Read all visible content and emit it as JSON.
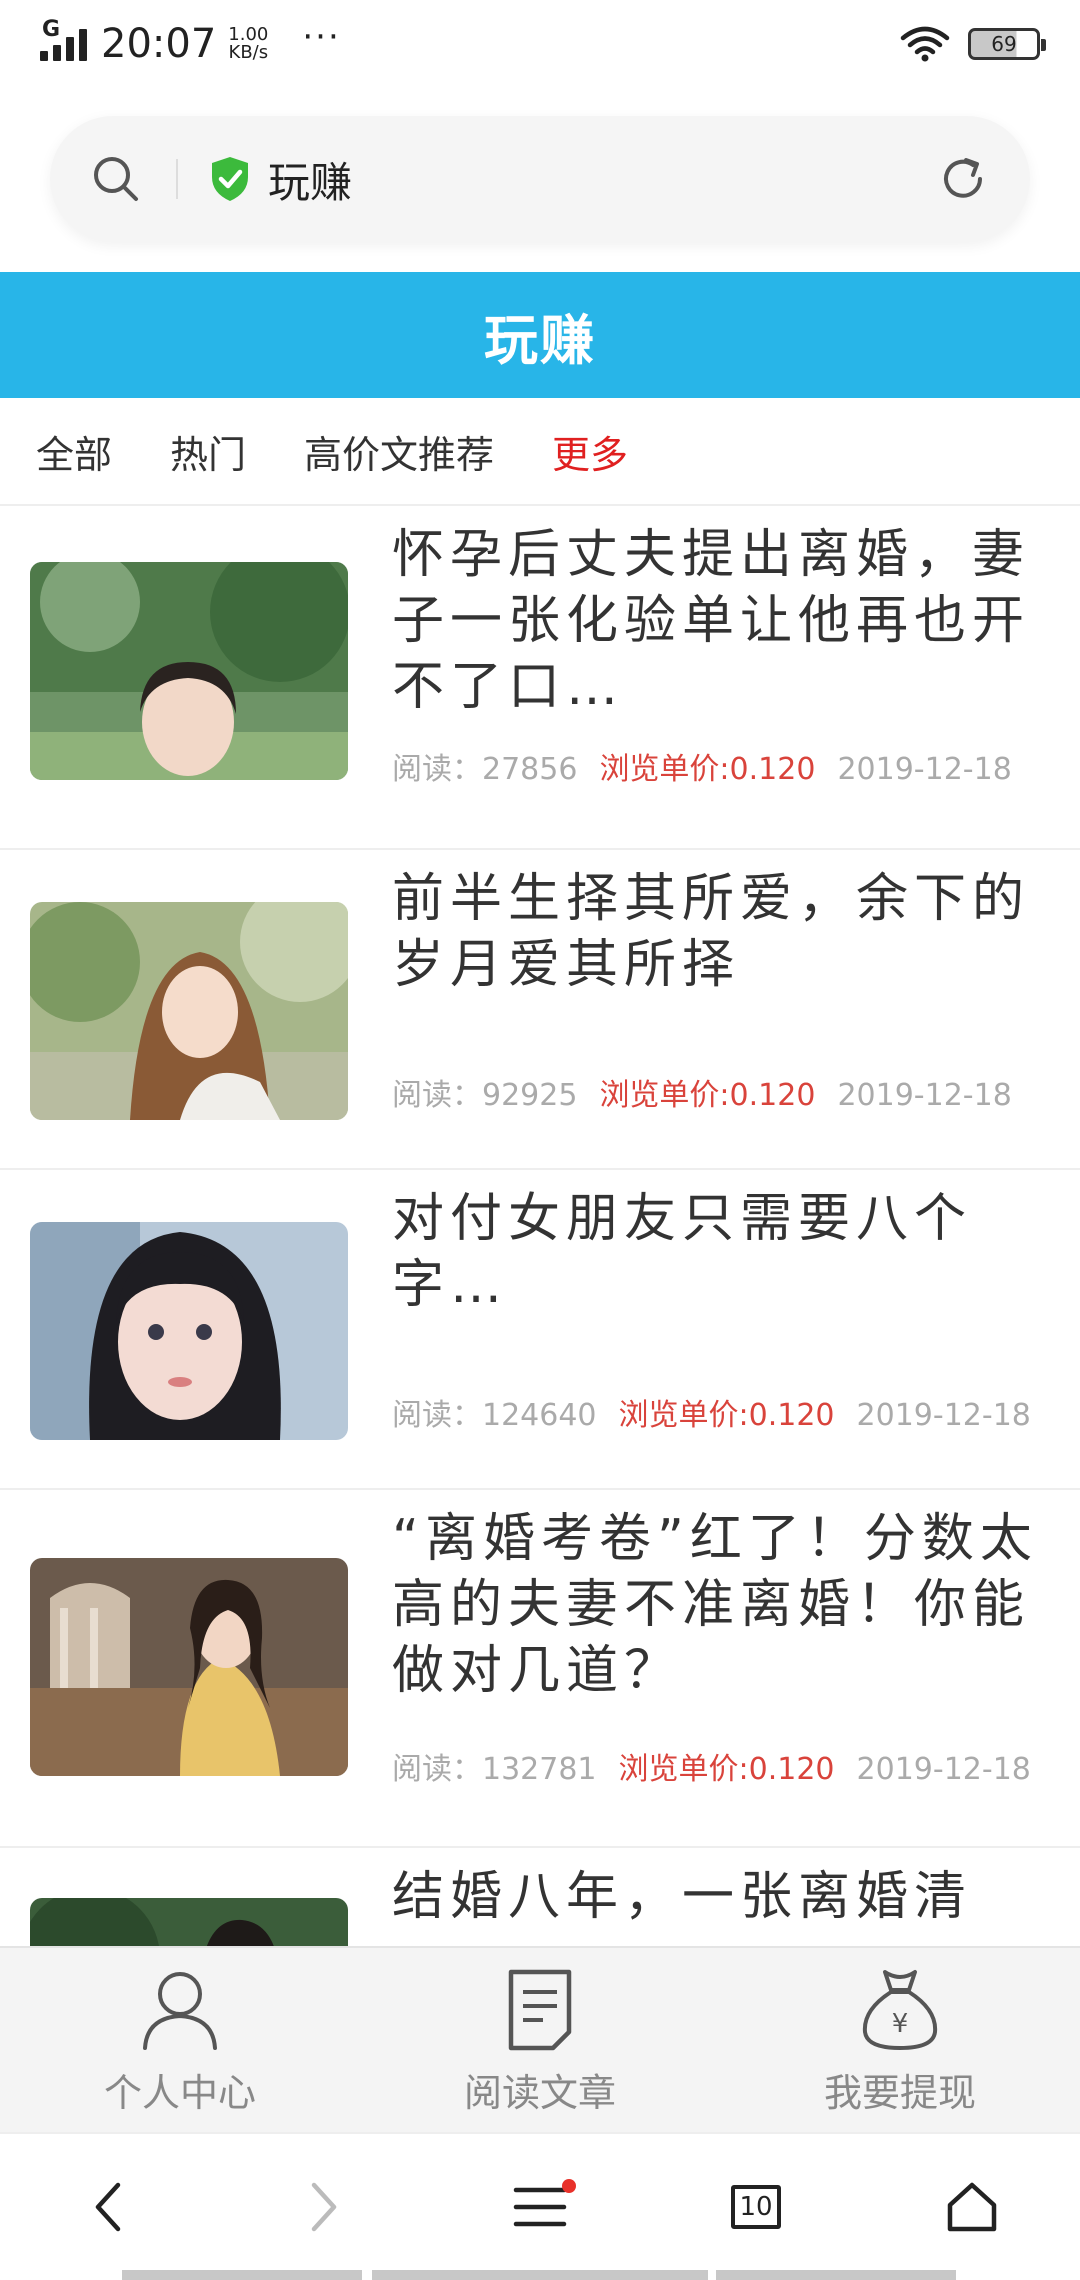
{
  "status_bar": {
    "network": "G",
    "time": "20:07",
    "speed_value": "1.00",
    "speed_unit": "KB/s",
    "more": "···",
    "battery": "69"
  },
  "search": {
    "site_name": "玩赚",
    "shield_color": "#3cba3c"
  },
  "header": {
    "title": "玩赚",
    "color": "#28b5e8"
  },
  "tabs": [
    {
      "label": "全部"
    },
    {
      "label": "热门"
    },
    {
      "label": "高价文推荐"
    },
    {
      "label": "更多"
    }
  ],
  "articles": [
    {
      "title": "怀孕后丈夫提出离婚，妻子一张化验单让他再也开不了口…",
      "reads_label": "阅读：27856",
      "price_label": "浏览单价:0.120",
      "date": "2019-12-18"
    },
    {
      "title": "前半生择其所爱，余下的岁月爱其所择",
      "reads_label": "阅读：92925",
      "price_label": "浏览单价:0.120",
      "date": "2019-12-18"
    },
    {
      "title": "对付女朋友只需要八个字…",
      "reads_label": "阅读：124640",
      "price_label": "浏览单价:0.120",
      "date": "2019-12-18"
    },
    {
      "title": "“离婚考卷”红了！分数太高的夫妻不准离婚！你能做对几道？",
      "reads_label": "阅读：132781",
      "price_label": "浏览单价:0.120",
      "date": "2019-12-18"
    },
    {
      "title": "结婚八年，一张离婚清",
      "reads_label": "",
      "price_label": "",
      "date": ""
    }
  ],
  "bottom_nav": [
    {
      "label": "个人中心",
      "icon": "person-icon"
    },
    {
      "label": "阅读文章",
      "icon": "document-icon"
    },
    {
      "label": "我要提现",
      "icon": "money-bag-icon"
    }
  ],
  "browser_bar": {
    "tab_count": "10"
  }
}
